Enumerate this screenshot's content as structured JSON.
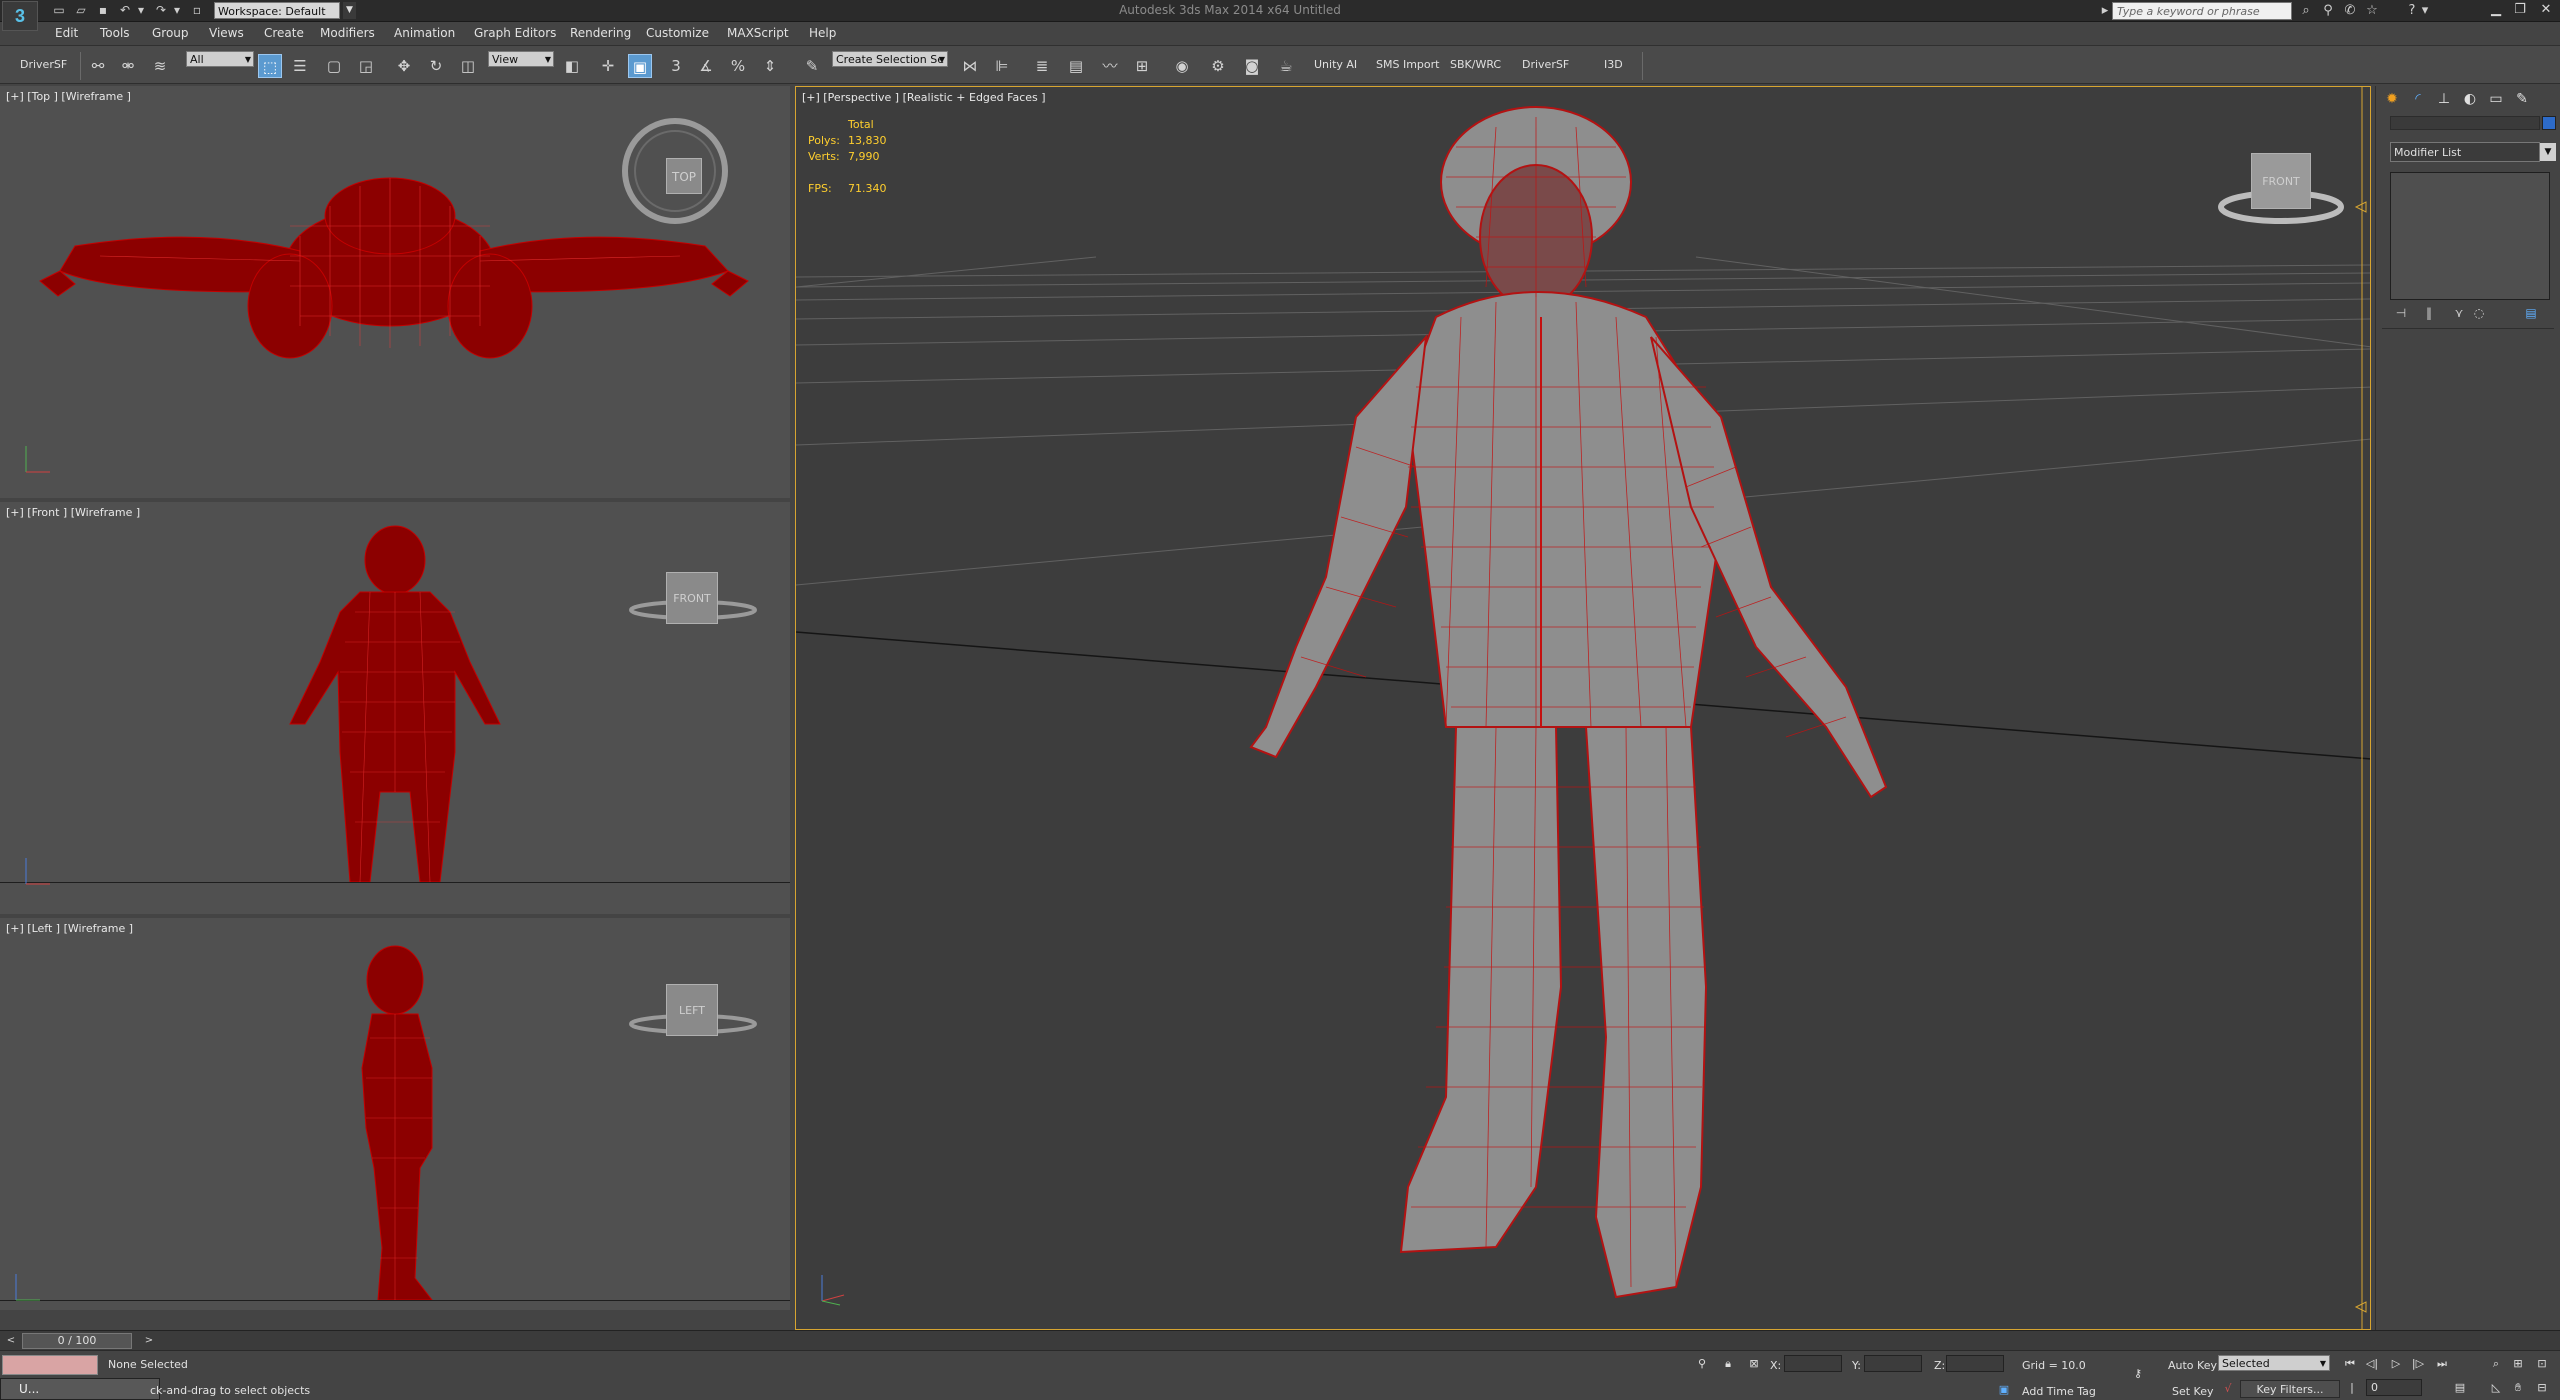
{
  "title_bar": {
    "window_title": "Autodesk 3ds Max 2014 x64    Untitled",
    "workspace": "Workspace: Default",
    "help_search_placeholder": "Type a keyword or phrase",
    "app_logo": "3"
  },
  "menu": [
    {
      "label": "Edit"
    },
    {
      "label": "Tools"
    },
    {
      "label": "Group"
    },
    {
      "label": "Views"
    },
    {
      "label": "Create"
    },
    {
      "label": "Modifiers"
    },
    {
      "label": "Animation"
    },
    {
      "label": "Graph Editors"
    },
    {
      "label": "Rendering"
    },
    {
      "label": "Customize"
    },
    {
      "label": "MAXScript"
    },
    {
      "label": "Help"
    }
  ],
  "toolbar": {
    "driver_left": "DriverSF",
    "filter_select": "All",
    "reference_coord": "View",
    "selection_set": "Create Selection Se",
    "unity_ai": "Unity AI",
    "sms_import": "SMS Import",
    "sbk_wrc": "SBK/WRC",
    "driver_right": "DriverSF",
    "i3d": "I3D",
    "snap_angle": "3",
    "percent_snap": "%"
  },
  "viewports": {
    "top": {
      "label": "[+] [Top ] [Wireframe ]",
      "cube": "TOP"
    },
    "front": {
      "label": "[+] [Front ] [Wireframe ]",
      "cube": "FRONT"
    },
    "left": {
      "label": "[+] [Left ] [Wireframe ]",
      "cube": "LEFT"
    },
    "perspective": {
      "label": "[+] [Perspective ] [Realistic + Edged Faces ]",
      "cube": "FRONT"
    }
  },
  "stats": {
    "header": "Total",
    "polys_label": "Polys:",
    "polys_value": "13,830",
    "verts_label": "Verts:",
    "verts_value": "7,990",
    "fps_label": "FPS:",
    "fps_value": "71.340"
  },
  "command_panel": {
    "modifier_list": "Modifier List"
  },
  "time_slider": {
    "frame": "0 / 100"
  },
  "status_bar": {
    "selection": "None Selected",
    "prompt": "ck-and-drag to select objects",
    "taskbar": "U...",
    "x_label": "X:",
    "y_label": "Y:",
    "z_label": "Z:",
    "grid": "Grid = 10.0",
    "add_time_tag": "Add Time Tag",
    "auto_key": "Auto Key",
    "set_key": "Set Key",
    "selected": "Selected",
    "key_filters": "Key Filters...",
    "current_frame": "0"
  },
  "colors": {
    "selection_wire": "#b30000",
    "active_viewport_border": "#d7a531",
    "stats_text": "#ffcf2e"
  }
}
